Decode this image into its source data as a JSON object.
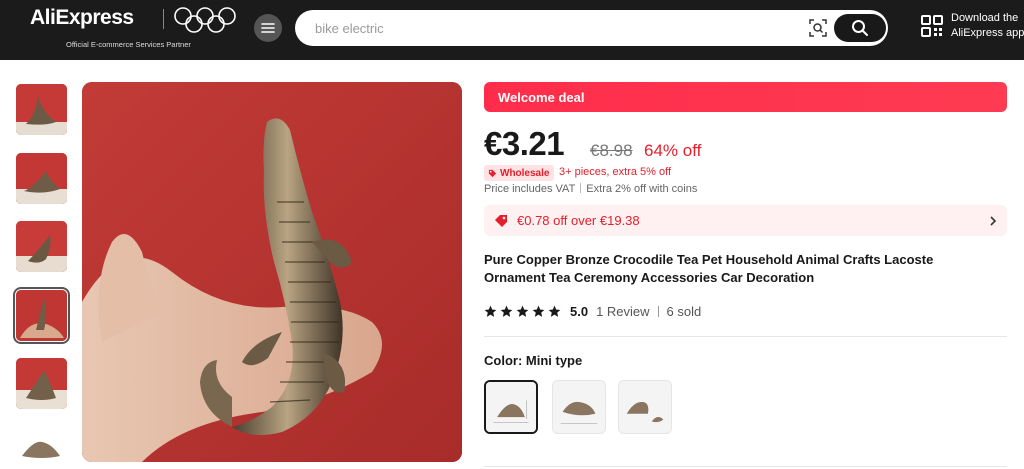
{
  "header": {
    "logo": "AliExpress",
    "tagline": "Official E-commerce Services Partner",
    "search_placeholder": "bike electric",
    "download_line1": "Download the",
    "download_line2": "AliExpress app"
  },
  "product": {
    "welcome_deal": "Welcome deal",
    "price": "€3.21",
    "original_price": "€8.98",
    "discount": "64% off",
    "wholesale_badge": "Wholesale",
    "wholesale_text": "3+ pieces, extra 5% off",
    "vat_text": "Price includes VAT",
    "coins_text": "Extra 2% off with coins",
    "coupon_text": "€0.78 off over €19.38",
    "title": "Pure Copper Bronze Crocodile Tea Pet Household Animal Crafts Lacoste Ornament Tea Ceremony Accessories Car Decoration",
    "rating_score": "5.0",
    "reviews": "1 Review",
    "sold": "6 sold",
    "color_label": "Color: Mini type",
    "stars": 5
  },
  "colors": {
    "accent": "#fe2c4a",
    "price_red": "#e3202c",
    "header_bg": "#1b1b1b"
  },
  "icons": [
    "menu-icon",
    "camera-search-icon",
    "search-icon",
    "qr-code-icon",
    "tag-icon",
    "coupon-icon",
    "chevron-right-icon",
    "star-icon"
  ]
}
